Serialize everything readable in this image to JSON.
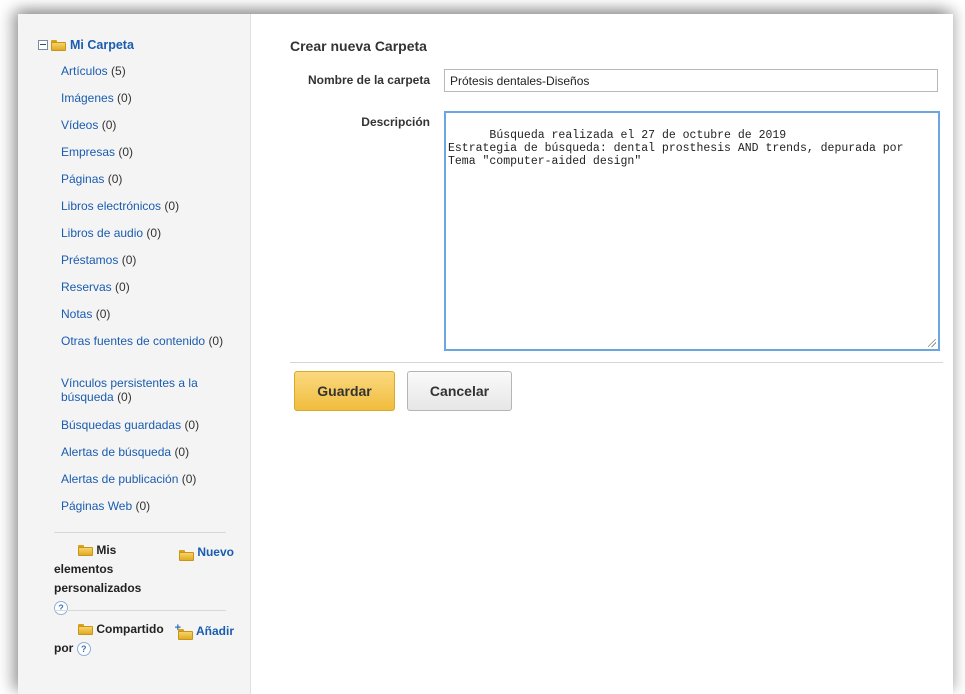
{
  "sidebar": {
    "root_label": "Mi Carpeta",
    "items": [
      {
        "label": "Artículos",
        "count": "(5)"
      },
      {
        "label": "Imágenes",
        "count": "(0)"
      },
      {
        "label": "Vídeos",
        "count": "(0)"
      },
      {
        "label": "Empresas",
        "count": "(0)"
      },
      {
        "label": "Páginas",
        "count": "(0)"
      },
      {
        "label": "Libros electrónicos",
        "count": "(0)"
      },
      {
        "label": "Libros de audio",
        "count": "(0)"
      },
      {
        "label": "Préstamos",
        "count": "(0)"
      },
      {
        "label": "Reservas",
        "count": "(0)"
      },
      {
        "label": "Notas",
        "count": "(0)"
      },
      {
        "label": "Otras fuentes de contenido",
        "count": "(0)"
      },
      {
        "label": "Vínculos persistentes a la búsqueda",
        "count": "(0)"
      },
      {
        "label": "Búsquedas guardadas",
        "count": "(0)"
      },
      {
        "label": "Alertas de búsqueda",
        "count": "(0)"
      },
      {
        "label": "Alertas de publicación",
        "count": "(0)"
      },
      {
        "label": "Páginas Web",
        "count": "(0)"
      }
    ],
    "custom": {
      "label": "Mis elementos personalizados",
      "new_label": "Nuevo",
      "help": "?"
    },
    "shared": {
      "label": "Compartido por",
      "add_label": "Añadir",
      "help": "?"
    }
  },
  "form": {
    "title": "Crear nueva Carpeta",
    "name_label": "Nombre de la carpeta",
    "name_value": "Prótesis dentales-Diseños",
    "desc_label": "Descripción",
    "desc_value": "Búsqueda realizada el 27 de octubre de 2019\nEstrategia de búsqueda: dental prosthesis AND trends, depurada por\nTema \"computer-aided design\"",
    "save_label": "Guardar",
    "cancel_label": "Cancelar"
  },
  "colors": {
    "link": "#1a5cb0",
    "save_button": "#f0bd3d",
    "focus_border": "#6aa7e0"
  },
  "icons": [
    "collapse-icon",
    "folder-icon",
    "add-folder-icon",
    "help-icon"
  ]
}
